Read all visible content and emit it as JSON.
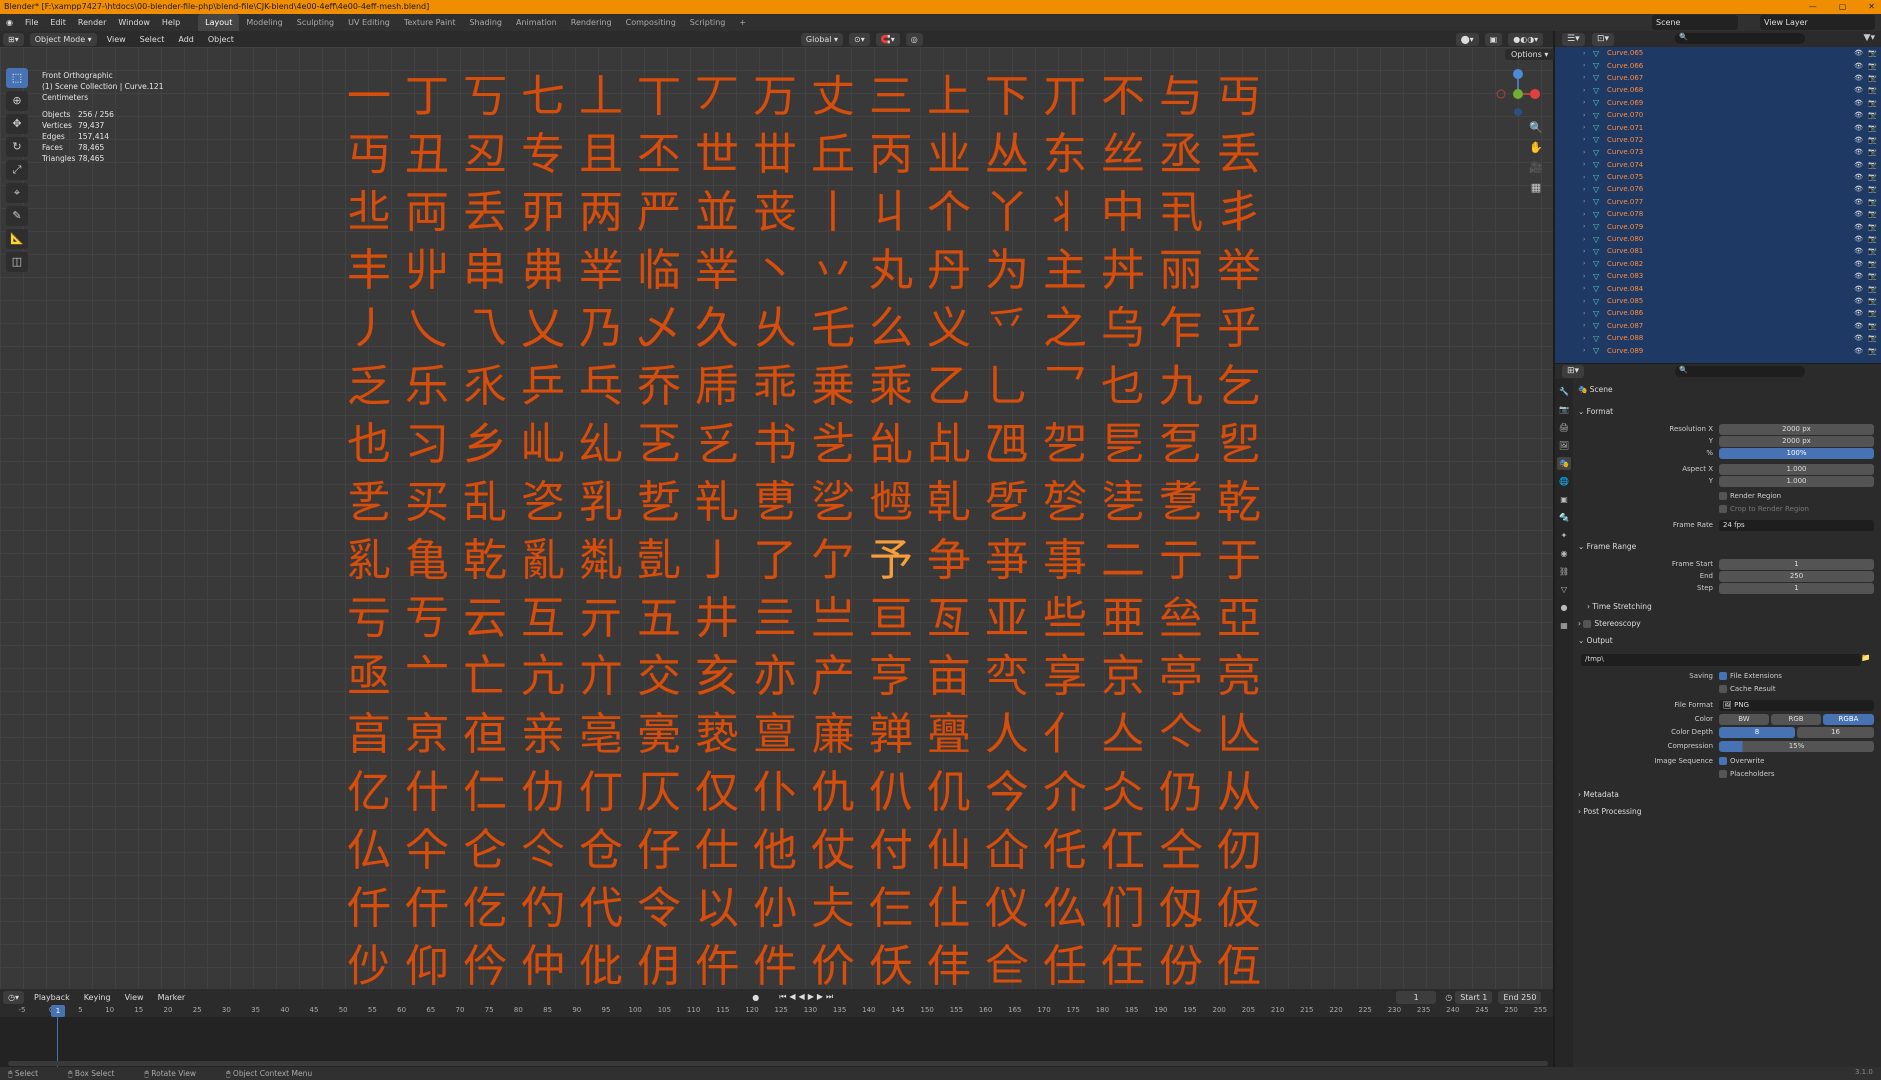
{
  "window": {
    "title": "Blender* [F:\\xampp7427-\\htdocs\\00-blender-file-php\\blend-file\\CJK-blend\\4e00-4eff\\4e00-4eff-mesh.blend]"
  },
  "menu": [
    "File",
    "Edit",
    "Render",
    "Window",
    "Help"
  ],
  "workspaces": [
    "Layout",
    "Modeling",
    "Sculpting",
    "UV Editing",
    "Texture Paint",
    "Shading",
    "Animation",
    "Rendering",
    "Compositing",
    "Scripting"
  ],
  "active_workspace": "Layout",
  "scene_name": "Scene",
  "view_layer": "View Layer",
  "viewport_header": {
    "mode": "Object Mode",
    "menus": [
      "View",
      "Select",
      "Add",
      "Object"
    ],
    "transform_orientation": "Global",
    "options": "Options"
  },
  "viewport_info": {
    "view": "Front Orthographic",
    "collection": "(1) Scene Collection | Curve.121",
    "units": "Centimeters",
    "stats": [
      {
        "label": "Objects",
        "value": "256 / 256"
      },
      {
        "label": "Vertices",
        "value": "79,437"
      },
      {
        "label": "Edges",
        "value": "157,414"
      },
      {
        "label": "Faces",
        "value": "78,465"
      },
      {
        "label": "Triangles",
        "value": "78,465"
      }
    ]
  },
  "chars": "一丁丂七丄丅丆万丈三上下丌不与丏丏丑丒专且丕世丗丘丙业丛东丝丞丢丠両丢丣两严並丧丨丩个丫丬中丮丯丰丱串丳丵临丵丶丷丸丹为主丼丽举丿乀乁乂乃乄久乆乇么义乊之乌乍乎乏乐乑乒乓乔乕乖乗乘乙乚乛乜九乞也习乡乢乣乤乥书乧乨乩乪乫乬乭乮乯买乱乲乳乴乵乶乷乸乹乺乻乼乽乾乿亀乾亂亃亄亅了亇予争亊事二亍于亏亐云互亓五井亖亗亘亙亚些亜亝亞亟亠亡亢亣交亥亦产亨亩亪享京亭亮亯亰亱亲亳亴亵亶亷亸亹人亻亼亽亾亿什仁仂仃仄仅仆仇仈仉今介仌仍从仏仐仑仒仓仔仕他仗付仙仚仛仜仝仞仟仠仡仢代令以仦仧仨仩仪仫们仭仮仯仰仱仲仳仴仵件价仸仹仺任仼份仾仿",
  "selected_char_index": 137,
  "outliner": {
    "items": [
      "Curve.065",
      "Curve.066",
      "Curve.067",
      "Curve.068",
      "Curve.069",
      "Curve.070",
      "Curve.071",
      "Curve.072",
      "Curve.073",
      "Curve.074",
      "Curve.075",
      "Curve.076",
      "Curve.077",
      "Curve.078",
      "Curve.079",
      "Curve.080",
      "Curve.081",
      "Curve.082",
      "Curve.083",
      "Curve.084",
      "Curve.085",
      "Curve.086",
      "Curve.087",
      "Curve.088",
      "Curve.089"
    ]
  },
  "properties": {
    "context": "Scene",
    "format": {
      "title": "Format",
      "res_x_label": "Resolution X",
      "res_x": "2000 px",
      "res_y_label": "Y",
      "res_y": "2000 px",
      "pct_label": "%",
      "pct": "100%",
      "aspect_x_label": "Aspect X",
      "aspect_x": "1.000",
      "aspect_y_label": "Y",
      "aspect_y": "1.000",
      "render_region": "Render Region",
      "crop": "Crop to Render Region",
      "frame_rate_label": "Frame Rate",
      "frame_rate": "24 fps"
    },
    "frame_range": {
      "title": "Frame Range",
      "start_label": "Frame Start",
      "start": "1",
      "end_label": "End",
      "end": "250",
      "step_label": "Step",
      "step": "1",
      "time_stretching": "Time Stretching"
    },
    "stereoscopy": "Stereoscopy",
    "output": {
      "title": "Output",
      "path": "/tmp\\",
      "saving_label": "Saving",
      "file_ext": "File Extensions",
      "cache": "Cache Result",
      "format_label": "File Format",
      "format": "PNG",
      "color_label": "Color",
      "color_opts": [
        "BW",
        "RGB",
        "RGBA"
      ],
      "color_sel": "RGBA",
      "depth_label": "Color Depth",
      "depth_opts": [
        "8",
        "16"
      ],
      "depth_sel": "8",
      "comp_label": "Compression",
      "comp": "15%",
      "seq_label": "Image Sequence",
      "overwrite": "Overwrite",
      "placeholders": "Placeholders"
    },
    "metadata": "Metadata",
    "post": "Post Processing"
  },
  "timeline": {
    "menus": [
      "Playback",
      "Keying",
      "View",
      "Marker"
    ],
    "current": "1",
    "start_label": "Start",
    "start": "1",
    "end_label": "End",
    "end": "250",
    "ticks": [
      "-5",
      "0",
      "5",
      "10",
      "15",
      "20",
      "25",
      "30",
      "35",
      "40",
      "45",
      "50",
      "55",
      "60",
      "65",
      "70",
      "75",
      "80",
      "85",
      "90",
      "95",
      "100",
      "105",
      "110",
      "115",
      "120",
      "125",
      "130",
      "135",
      "140",
      "145",
      "150",
      "155",
      "160",
      "165",
      "170",
      "175",
      "180",
      "185",
      "190",
      "195",
      "200",
      "205",
      "210",
      "215",
      "220",
      "225",
      "230",
      "235",
      "240",
      "245",
      "250",
      "255"
    ]
  },
  "statusbar": [
    "Select",
    "Box Select",
    "Rotate View",
    "Object Context Menu"
  ],
  "version": "3.1.0"
}
